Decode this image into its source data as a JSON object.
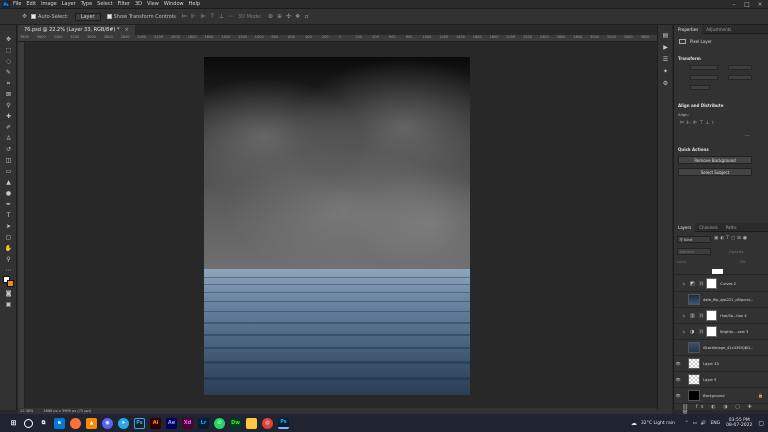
{
  "menubar": {
    "app_icon": "Ps",
    "items": [
      "File",
      "Edit",
      "Image",
      "Layer",
      "Type",
      "Select",
      "Filter",
      "3D",
      "View",
      "Window",
      "Help"
    ],
    "window_controls": [
      "minimize-icon",
      "maximize-icon",
      "close-icon"
    ]
  },
  "options": {
    "auto_select_label": "Auto-Select:",
    "auto_select_value": "Layer",
    "transform_label": "Show Transform Controls",
    "mode_label": "3D Mode:"
  },
  "document": {
    "tab_title": "76.psd @ 22.2% (Layer 33, RGB/8#) *",
    "close_glyph": "×"
  },
  "ruler_ticks": [
    "3800",
    "3600",
    "3400",
    "3200",
    "3000",
    "2800",
    "2600",
    "2400",
    "2200",
    "2000",
    "1800",
    "1600",
    "1400",
    "1200",
    "1000",
    "800",
    "600",
    "400",
    "200",
    "0",
    "200",
    "400",
    "600",
    "800",
    "1000",
    "1200",
    "1400",
    "1600",
    "1800",
    "2000",
    "2200",
    "2400",
    "2600",
    "2800",
    "3000",
    "3200",
    "3400",
    "3600",
    "3800"
  ],
  "status": {
    "zoom": "22.38%",
    "doc_size": "2666 px x 3999 px (72 ppi)"
  },
  "properties": {
    "tabs": [
      "Properties",
      "Adjustments"
    ],
    "layer_type": "Pixel Layer",
    "transform_title": "Transform",
    "align_title": "Align and Distribute",
    "align_label": "Align:",
    "quick_actions_title": "Quick Actions",
    "remove_bg_label": "Remove Background",
    "select_subject_label": "Select Subject"
  },
  "layers": {
    "tabs": [
      "Layers",
      "Channels",
      "Paths"
    ],
    "filter_label": "Kind",
    "blend_mode": "Normal",
    "opacity_label": "Opacity:",
    "lock_label": "Lock:",
    "fill_label": "Fill:",
    "items": [
      {
        "name": "Curves 2",
        "kind": "adjust",
        "visible": false
      },
      {
        "name": "date_flip_ajst221_d5lpcnd...",
        "kind": "photo",
        "visible": false
      },
      {
        "name": "Hue/Sa...tion 4",
        "kind": "adjust",
        "visible": false
      },
      {
        "name": "Brightn....rast 3",
        "kind": "adjust",
        "visible": false
      },
      {
        "name": "iStockImage_42x33SfQBQ...",
        "kind": "photo",
        "visible": false
      },
      {
        "name": "Layer 33",
        "kind": "checker",
        "visible": true
      },
      {
        "name": "Layer 9",
        "kind": "checker",
        "visible": true
      },
      {
        "name": "Background",
        "kind": "black",
        "visible": true
      }
    ]
  },
  "taskbar": {
    "apps": [
      "Ps",
      "Ai",
      "Ae",
      "Dw",
      "Lr",
      "Xd",
      "Ps"
    ],
    "weather": "32°C  Light rain",
    "language": "ENG",
    "time": "03:55 PM",
    "date": "08-07-2022"
  },
  "colors": {
    "accent": "#31a8ff",
    "foreground": "#ffffff",
    "background": "#e8892a"
  }
}
